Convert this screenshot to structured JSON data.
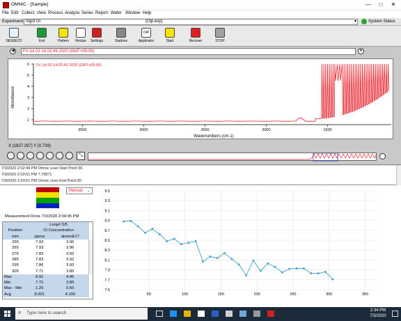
{
  "window": {
    "title": "OMNIC - [Sample]",
    "minimize": "—",
    "maximize": "□",
    "close": "✕"
  },
  "menu": [
    "File",
    "Edit",
    "Collect",
    "View",
    "Process",
    "Analyze",
    "Series",
    "Report",
    "Wafer",
    "Window",
    "Help"
  ],
  "experiment": {
    "label": "Experiment:",
    "value": "Ingot Oi",
    "file": "(Oip.exp)",
    "status": "System Status"
  },
  "toolbar": [
    {
      "label": "SES0ECD",
      "icon": "monitor-icon"
    },
    {
      "label": "Exit",
      "icon": "exit-icon"
    },
    {
      "label": "Pattern",
      "icon": "pattern-icon"
    },
    {
      "label": "Recipe",
      "icon": "recipe-icon"
    },
    {
      "label": "Settings",
      "icon": "settings-icon"
    },
    {
      "label": "Stations",
      "icon": "stations-icon"
    },
    {
      "label": "Applicator",
      "icon": "applicator-icon"
    },
    {
      "label": "Start",
      "icon": "start-icon"
    },
    {
      "label": "Recover",
      "icon": "recover-icon"
    },
    {
      "label": "STOP",
      "icon": "stop-icon"
    }
  ],
  "spectrum": {
    "header_text": "Fri Jul 03 14:02:49 2020 (GMT+09:00)",
    "legend": "Fri Jul 03 14:02:49 2020 (GMT+09:00)",
    "ylabel": "Absorbance",
    "xlabel": "Wavenumbers (cm-1)",
    "yticks": [
      "6",
      "5",
      "4",
      "3",
      "2",
      "1"
    ],
    "xticks": [
      "3500",
      "3000",
      "2500",
      "2000",
      "1500"
    ],
    "line_color": "#e8202a"
  },
  "coord_readout": "X (1827.297)  Y (0.739)",
  "log": [
    "7/3/2020 2:02:49 PM Omnic scan Start Point:30",
    "7/3/2020 2:03:51 PM 7.70871",
    "7/3/2020 2:03:51 PM Omnic scan End  Point:30"
  ],
  "measurement": {
    "mode": "Manual",
    "done_text": "Measurement Done 7/3/2020 2:04:05 PM",
    "loop": "Loop# 5/5",
    "columns": [
      "Position",
      "Oi Concentration"
    ],
    "units": [
      "mm",
      "ppma",
      "atomsE17"
    ],
    "rows": [
      [
        "255",
        "7.93",
        "3.96"
      ],
      [
        "265",
        "7.93",
        "3.96"
      ],
      [
        "275",
        "7.83",
        "3.92"
      ],
      [
        "285",
        "7.83",
        "3.92"
      ],
      [
        "295",
        "7.86",
        "3.93"
      ],
      [
        "305",
        "7.71",
        "3.85"
      ]
    ],
    "summary": [
      [
        "Max",
        "8.91",
        "4.46"
      ],
      [
        "Min",
        "7.71",
        "3.85"
      ],
      [
        "Max - Min",
        "1.20",
        "0.60"
      ],
      [
        "Avg",
        "8.201",
        "4.100"
      ]
    ],
    "swatch_colors": [
      "#c00000",
      "#f0e000",
      "#00a000",
      "#0020c0"
    ]
  },
  "chart_data": {
    "type": "line",
    "x": [
      15,
      25,
      35,
      45,
      55,
      65,
      75,
      85,
      95,
      105,
      115,
      125,
      135,
      145,
      155,
      165,
      175,
      185,
      195,
      205,
      215,
      225,
      235,
      245,
      255,
      265,
      275,
      285,
      295,
      305
    ],
    "y": [
      8.88,
      8.89,
      8.78,
      8.65,
      8.73,
      8.62,
      8.48,
      8.53,
      8.42,
      8.45,
      8.48,
      8.07,
      8.17,
      8.14,
      8.24,
      8.12,
      8.01,
      7.79,
      8.09,
      7.88,
      8.03,
      7.96,
      7.85,
      7.92,
      7.93,
      7.93,
      7.83,
      7.83,
      7.86,
      7.71
    ],
    "yticks": [
      "9.5",
      "9.3",
      "9.1",
      "8.9",
      "8.7",
      "8.5",
      "8.3",
      "8.1",
      "7.9",
      "7.7",
      "7.5"
    ],
    "xticks": [
      "50",
      "100",
      "150",
      "200",
      "250",
      "300",
      "350"
    ],
    "xlim": [
      0,
      365
    ],
    "ylim": [
      7.5,
      9.5
    ],
    "grid": true,
    "color": "#3fa3c8"
  },
  "taskbar": {
    "search": "Type here to search",
    "time": "2:34 PM",
    "date": "7/3/2020"
  }
}
